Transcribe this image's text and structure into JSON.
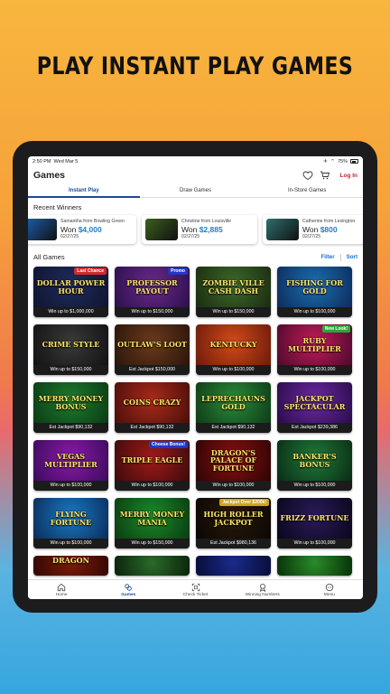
{
  "headline": "PLAY INSTANT PLAY GAMES",
  "status": {
    "time": "2:50 PM",
    "date": "Wed Mar 5",
    "battery": "75%"
  },
  "header": {
    "title": "Games",
    "login_label": "Log In"
  },
  "tabs": [
    {
      "label": "Instant Play",
      "active": true
    },
    {
      "label": "Draw Games",
      "active": false
    },
    {
      "label": "In-Store Games",
      "active": false
    }
  ],
  "recent_winners": {
    "title": "Recent Winners",
    "items": [
      {
        "name": "Samantha from Bowling Green",
        "won_label": "Won",
        "amount": "$4,000",
        "date": "02/27/25",
        "thumb_color": "#1b5fae"
      },
      {
        "name": "Christine from Louisville",
        "won_label": "Won",
        "amount": "$2,885",
        "date": "02/27/25",
        "thumb_color": "#3c5f1e"
      },
      {
        "name": "Catherine from Lexington",
        "won_label": "Won",
        "amount": "$800",
        "date": "02/27/25",
        "thumb_color": "#2d6f6e"
      }
    ]
  },
  "all_games": {
    "title": "All Games",
    "filter_label": "Filter",
    "sort_label": "Sort",
    "games": [
      {
        "art": "DOLLAR POWER HOUR",
        "footer": "Win up to $1,000,000",
        "badge": "Last Chance",
        "badge_color": "#d22a2a",
        "bg": "#1f2b5a",
        "bg2": "#0f1430"
      },
      {
        "art": "PROFESSOR PAYOUT",
        "footer": "Win up to $150,000",
        "badge": "Promo",
        "badge_color": "#2037c9",
        "bg": "#6a2a8a",
        "bg2": "#2a0f4a"
      },
      {
        "art": "ZOMBIE VILLE CASH DASH",
        "footer": "Win up to $150,000",
        "badge": "",
        "badge_color": "",
        "bg": "#3d6a2a",
        "bg2": "#1a2a10"
      },
      {
        "art": "FISHING FOR GOLD",
        "footer": "Win up to $100,000",
        "badge": "",
        "badge_color": "",
        "bg": "#1c6fb0",
        "bg2": "#0c2a5a"
      },
      {
        "art": "CRIME STYLE",
        "footer": "Win up to $150,000",
        "badge": "",
        "badge_color": "",
        "bg": "#3a3a3a",
        "bg2": "#111111"
      },
      {
        "art": "OUTLAW'S LOOT",
        "footer": "Est Jackpot $150,000",
        "badge": "",
        "badge_color": "",
        "bg": "#6a3a1c",
        "bg2": "#2a140a"
      },
      {
        "art": "KENTUCKY",
        "footer": "Win up to $100,000",
        "badge": "",
        "badge_color": "",
        "bg": "#d24a1a",
        "bg2": "#6a1a0a"
      },
      {
        "art": "RUBY MULTIPLIER",
        "footer": "Win up to $100,000",
        "badge": "New Look!",
        "badge_color": "#2aa83a",
        "bg": "#c21a5a",
        "bg2": "#4a0a2a"
      },
      {
        "art": "MERRY MONEY BONUS",
        "footer": "Est Jackpot $90,132",
        "badge": "",
        "badge_color": "",
        "bg": "#1e7a2e",
        "bg2": "#0a3a14"
      },
      {
        "art": "COINS CRAZY",
        "footer": "Est Jackpot $90,132",
        "badge": "",
        "badge_color": "",
        "bg": "#a82a1a",
        "bg2": "#4a0e0a"
      },
      {
        "art": "LEPRECHAUNS GOLD",
        "footer": "Est Jackpot $90,132",
        "badge": "",
        "badge_color": "",
        "bg": "#2a8a3a",
        "bg2": "#0e3a16"
      },
      {
        "art": "JACKPOT SPECTACULAR",
        "footer": "Est Jackpot $239,386",
        "badge": "",
        "badge_color": "",
        "bg": "#6a2aa0",
        "bg2": "#2a0a4a"
      },
      {
        "art": "VEGAS MULTIPLIER",
        "footer": "Win up to $100,000",
        "badge": "",
        "badge_color": "",
        "bg": "#8a1aa8",
        "bg2": "#3a0a5a"
      },
      {
        "art": "TRIPLE EAGLE",
        "footer": "Win up to $100,000",
        "badge": "Choose Bonus!",
        "badge_color": "#2037c9",
        "bg": "#a01a1a",
        "bg2": "#3a0a0a"
      },
      {
        "art": "DRAGON'S PALACE OF FORTUNE",
        "footer": "Win up to $100,000",
        "badge": "",
        "badge_color": "",
        "bg": "#8a1010",
        "bg2": "#2a0404"
      },
      {
        "art": "BANKER'S BONUS",
        "footer": "Win up to $100,000",
        "badge": "",
        "badge_color": "",
        "bg": "#1f7a3a",
        "bg2": "#0a2a14"
      },
      {
        "art": "FLYING FORTUNE",
        "footer": "Win up to $100,000",
        "badge": "",
        "badge_color": "",
        "bg": "#1a7ac2",
        "bg2": "#0a2a5a"
      },
      {
        "art": "MERRY MONEY MANIA",
        "footer": "Win up to $150,000",
        "badge": "",
        "badge_color": "",
        "bg": "#1a8a2a",
        "bg2": "#0a3a10"
      },
      {
        "art": "HIGH ROLLER JACKPOT",
        "footer": "Est Jackpot $980,136",
        "badge": "Jackpot Over $200k!",
        "badge_color": "#d2a41a",
        "bg": "#2a1a0a",
        "bg2": "#0a0604"
      },
      {
        "art": "FRIZZ FORTUNE",
        "footer": "Win up to $100,000",
        "badge": "",
        "badge_color": "",
        "bg": "#2a1a5a",
        "bg2": "#0a061a"
      },
      {
        "art": "DRAGON",
        "footer": "",
        "badge": "",
        "badge_color": "",
        "bg": "#7a1a0a",
        "bg2": "#3a0a04"
      },
      {
        "art": "",
        "footer": "",
        "badge": "",
        "badge_color": "",
        "bg": "#2a6a2a",
        "bg2": "#0e2a0e"
      },
      {
        "art": "",
        "footer": "",
        "badge": "",
        "badge_color": "",
        "bg": "#1a2a8a",
        "bg2": "#0a1040"
      },
      {
        "art": "",
        "footer": "",
        "badge": "",
        "badge_color": "",
        "bg": "#2a8a2a",
        "bg2": "#0a3a0a"
      }
    ]
  },
  "bottom_nav": [
    {
      "label": "Home",
      "icon": "home-icon",
      "active": false
    },
    {
      "label": "Games",
      "icon": "games-icon",
      "active": true
    },
    {
      "label": "Check Ticket",
      "icon": "scan-icon",
      "active": false
    },
    {
      "label": "Winning Numbers",
      "icon": "award-icon",
      "active": false
    },
    {
      "label": "Menu",
      "icon": "menu-dots-icon",
      "active": false
    }
  ],
  "colors": {
    "accent_blue": "#1a4a9a",
    "login_red": "#c0262e",
    "won_blue": "#1c7fd1"
  }
}
